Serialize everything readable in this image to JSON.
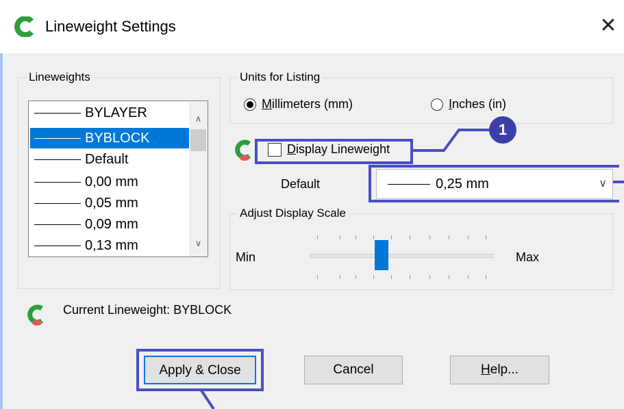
{
  "window": {
    "title": "Lineweight Settings",
    "close_glyph": "✕"
  },
  "lineweights": {
    "legend": "Lineweights",
    "items": [
      "BYLAYER",
      "BYBLOCK",
      "Default",
      "0,00 mm",
      "0,05 mm",
      "0,09 mm",
      "0,13 mm"
    ],
    "selected": "BYBLOCK",
    "scroll_up": "∧",
    "scroll_down": "∨"
  },
  "units": {
    "legend": "Units for Listing",
    "mm_mnemonic": "M",
    "mm_rest": "illimeters (mm)",
    "in_mnemonic": "I",
    "in_rest": "nches (in)",
    "selected": "Millimeters (mm)"
  },
  "display": {
    "mnemonic": "D",
    "rest": "isplay Lineweight",
    "checked": false
  },
  "default": {
    "label": "Default",
    "value": "0,25 mm",
    "chevron": "∨"
  },
  "scale": {
    "legend": "Adjust Display Scale",
    "min_label": "Min",
    "max_label": "Max"
  },
  "current": {
    "text": "Current Lineweight: BYBLOCK"
  },
  "buttons": {
    "apply": "Apply & Close",
    "cancel": "Cancel",
    "help_mnemonic": "H",
    "help_rest": "elp..."
  },
  "annotation": {
    "badge": "1"
  },
  "colors": {
    "accent": "#0078d7",
    "annotation": "#4a4fc1",
    "badge": "#3c3fa8",
    "icon_green": "#2e9e3a"
  },
  "icons": [
    "app-logo-icon",
    "close-icon",
    "chevron-down-icon",
    "app-status-icon"
  ]
}
